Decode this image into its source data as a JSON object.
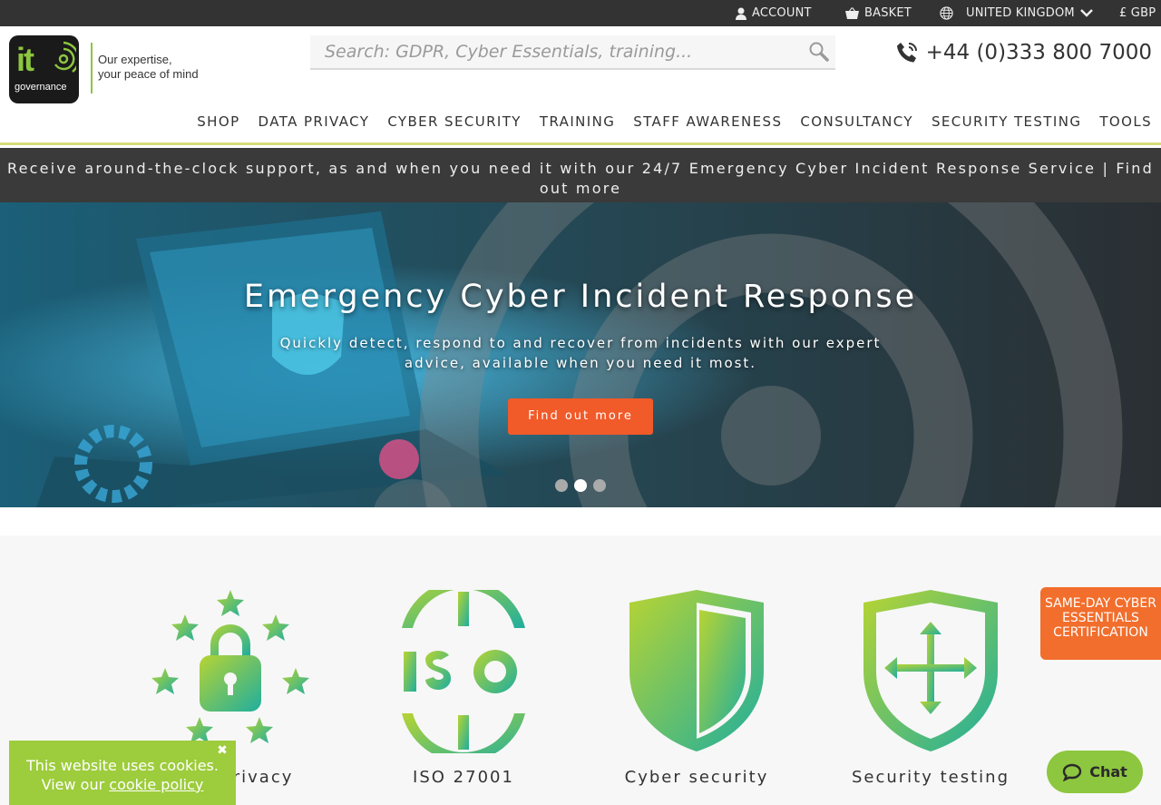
{
  "topbar": {
    "account": "ACCOUNT",
    "basket": "BASKET",
    "region": "UNITED KINGDOM",
    "currency": "£ GBP"
  },
  "logo": {
    "mark": "it",
    "sub": "governance",
    "tagline_1": "Our expertise,",
    "tagline_2": "your peace of mind"
  },
  "search": {
    "placeholder": "Search: GDPR, Cyber Essentials, training..."
  },
  "phone": "+44 (0)333 800 7000",
  "nav": [
    "SHOP",
    "DATA PRIVACY",
    "CYBER SECURITY",
    "TRAINING",
    "STAFF AWARENESS",
    "CONSULTANCY",
    "SECURITY TESTING",
    "TOOLS"
  ],
  "notice": "Receive around-the-clock support, as and when you need it with our 24/7 Emergency Cyber Incident Response Service | Find out more",
  "hero": {
    "title": "Emergency Cyber Incident Response",
    "subtitle": "Quickly detect, respond to and recover from incidents with our expert advice, available when you need it most.",
    "button": "Find out more",
    "active_slide": 2,
    "slide_count": 3
  },
  "categories": [
    {
      "label": "Data privacy",
      "icon": "padlock-stars-icon"
    },
    {
      "label": "ISO 27001",
      "icon": "iso-globe-icon"
    },
    {
      "label": "Cyber security",
      "icon": "shield-icon"
    },
    {
      "label": "Security testing",
      "icon": "shield-arrows-icon"
    }
  ],
  "cert_badge": "SAME-DAY CYBER ESSENTIALS CERTIFICATION",
  "cookie": {
    "line1": "This website uses cookies.",
    "line2_prefix": "View our",
    "link": "cookie policy"
  },
  "chat": "Chat",
  "colors": {
    "accent_green": "#8cc63f",
    "accent_orange": "#f15a29",
    "dark_bar": "#333333"
  }
}
